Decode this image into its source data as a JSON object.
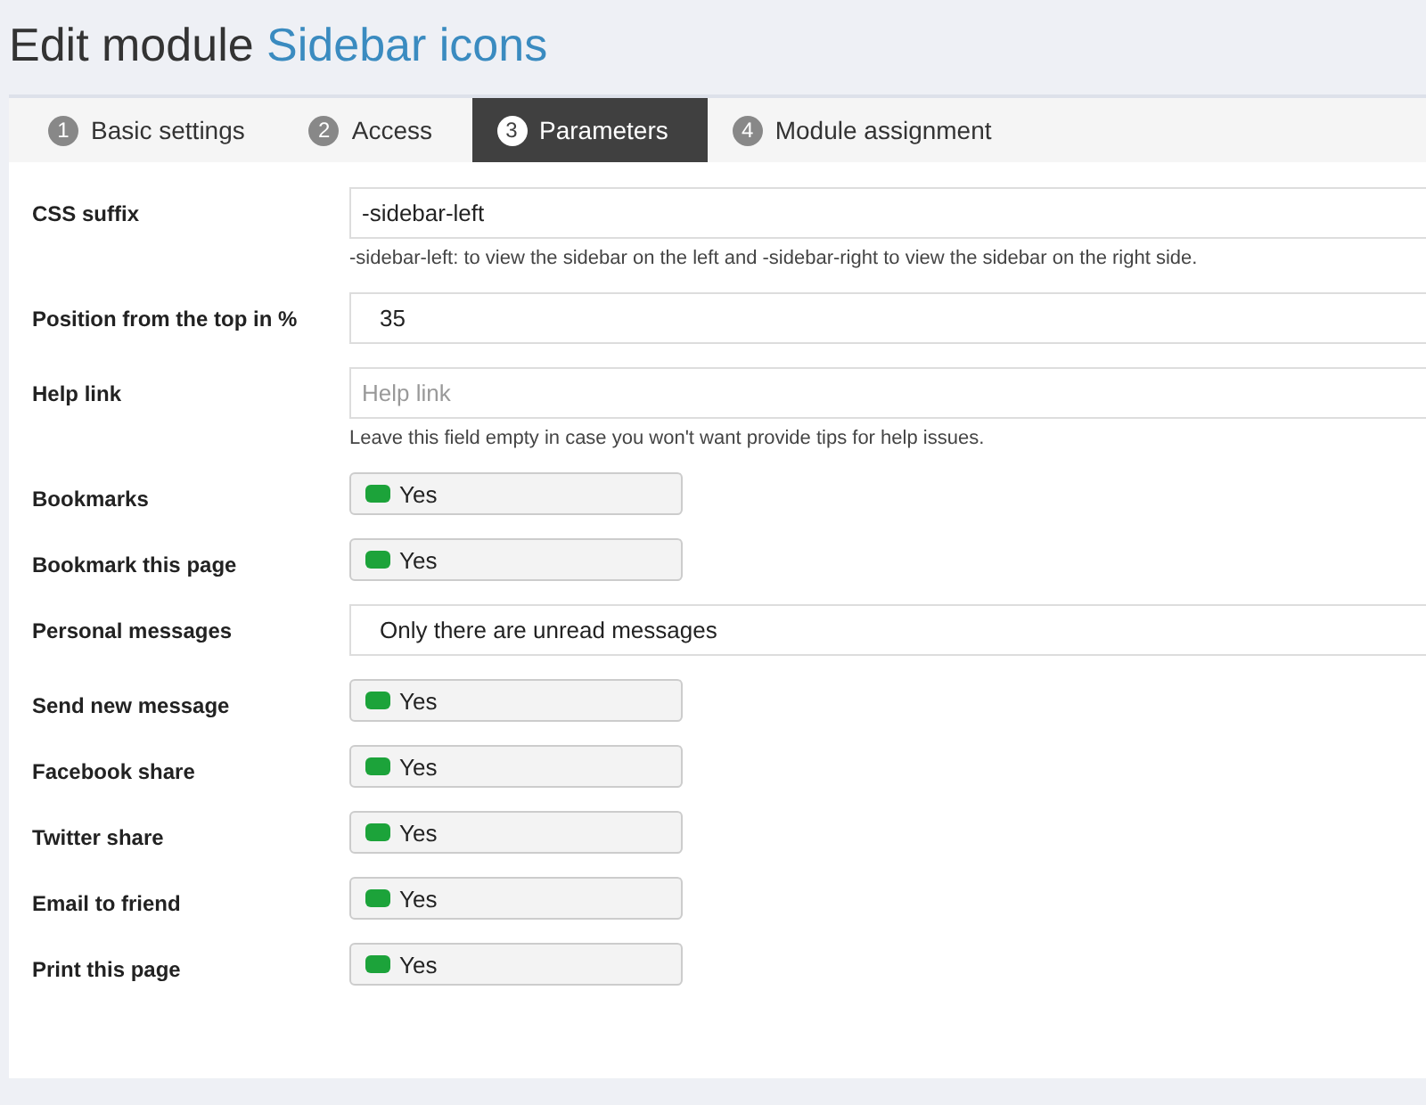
{
  "title": {
    "prefix": "Edit module",
    "name": "Sidebar icons"
  },
  "tabs": [
    {
      "number": "1",
      "label": "Basic settings",
      "selected": false
    },
    {
      "number": "2",
      "label": "Access",
      "selected": false
    },
    {
      "number": "3",
      "label": "Parameters",
      "selected": true
    },
    {
      "number": "4",
      "label": "Module assignment",
      "selected": false
    }
  ],
  "fields": [
    {
      "kind": "text",
      "label": "CSS suffix",
      "value": "-sidebar-left",
      "help": "-sidebar-left: to view the sidebar on the left and -sidebar-right to view the sidebar on the right side."
    },
    {
      "kind": "number",
      "label": "Position from the top in %",
      "value": "35"
    },
    {
      "kind": "text",
      "label": "Help link",
      "placeholder": "Help link",
      "help": "Leave this field empty in case you won't want provide tips for help issues."
    },
    {
      "kind": "toggle",
      "label": "Bookmarks",
      "value": "Yes",
      "on": true
    },
    {
      "kind": "toggle",
      "label": "Bookmark this page",
      "value": "Yes",
      "on": true
    },
    {
      "kind": "select",
      "label": "Personal messages",
      "value": "Only there are unread messages"
    },
    {
      "kind": "toggle",
      "label": "Send new message",
      "value": "Yes",
      "on": true
    },
    {
      "kind": "toggle",
      "label": "Facebook share",
      "value": "Yes",
      "on": true
    },
    {
      "kind": "toggle",
      "label": "Twitter share",
      "value": "Yes",
      "on": true
    },
    {
      "kind": "toggle",
      "label": "Email to friend",
      "value": "Yes",
      "on": true
    },
    {
      "kind": "toggle",
      "label": "Print this page",
      "value": "Yes",
      "on": true
    }
  ]
}
